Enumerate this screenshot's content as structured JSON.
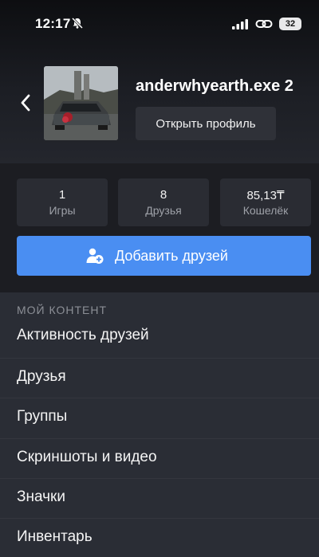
{
  "status_bar": {
    "time": "12:17",
    "battery": "32"
  },
  "profile": {
    "username": "anderwhyearth.exe 2",
    "open_profile_label": "Открыть профиль"
  },
  "stats": [
    {
      "value": "1",
      "label": "Игры"
    },
    {
      "value": "8",
      "label": "Друзья"
    },
    {
      "value": "85,13₸",
      "label": "Кошелёк"
    }
  ],
  "add_friends_label": "Добавить друзей",
  "section": {
    "title": "МОЙ КОНТЕНТ",
    "items": [
      {
        "label": "Активность друзей"
      },
      {
        "label": "Друзья"
      },
      {
        "label": "Группы"
      },
      {
        "label": "Скриншоты и видео"
      },
      {
        "label": "Значки"
      },
      {
        "label": "Инвентарь"
      }
    ]
  },
  "colors": {
    "accent": "#4a8ef2",
    "background": "#2a2d35"
  }
}
